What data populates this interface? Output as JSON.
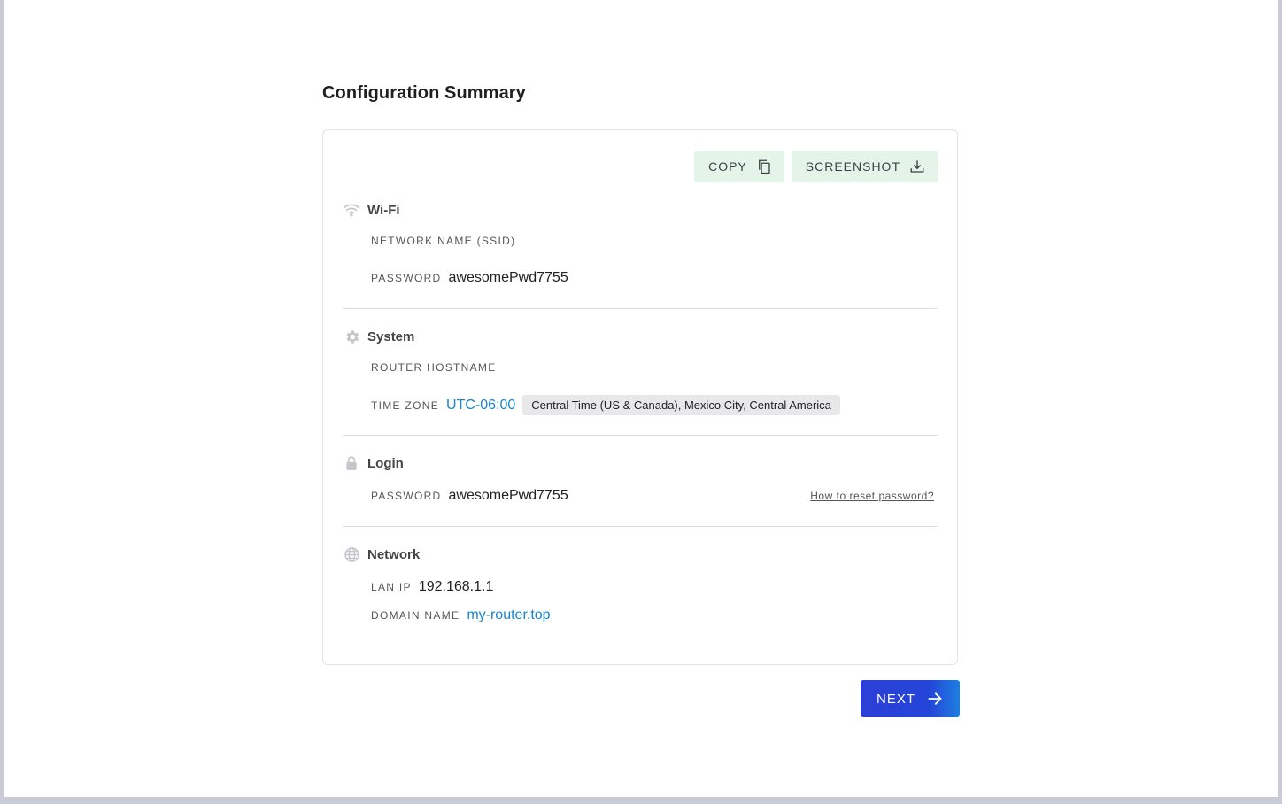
{
  "page": {
    "title": "Configuration Summary"
  },
  "toolbar": {
    "copy_label": "COPY",
    "screenshot_label": "SCREENSHOT"
  },
  "wifi": {
    "title": "Wi-Fi",
    "ssid_label": "NETWORK NAME (SSID)",
    "password_label": "PASSWORD",
    "password_value": "awesomePwd7755"
  },
  "system": {
    "title": "System",
    "hostname_label": "ROUTER HOSTNAME",
    "timezone_label": "TIME ZONE",
    "timezone_value": "UTC-06:00",
    "timezone_name": "Central Time (US & Canada), Mexico City, Central America"
  },
  "login": {
    "title": "Login",
    "password_label": "PASSWORD",
    "password_value": "awesomePwd7755",
    "reset_link": "How to reset password?"
  },
  "network": {
    "title": "Network",
    "lan_label": "LAN IP",
    "lan_value": "192.168.1.1",
    "domain_label": "DOMAIN NAME",
    "domain_value": "my-router.top"
  },
  "footer": {
    "next_label": "NEXT"
  },
  "colors": {
    "accent": "#2b3fd6",
    "link": "#1a85c8",
    "toolbar_bg": "#e5f4e9"
  },
  "icons": [
    "wifi-icon",
    "gear-icon",
    "lock-icon",
    "globe-icon",
    "copy-icon",
    "download-icon",
    "arrow-right-icon"
  ]
}
